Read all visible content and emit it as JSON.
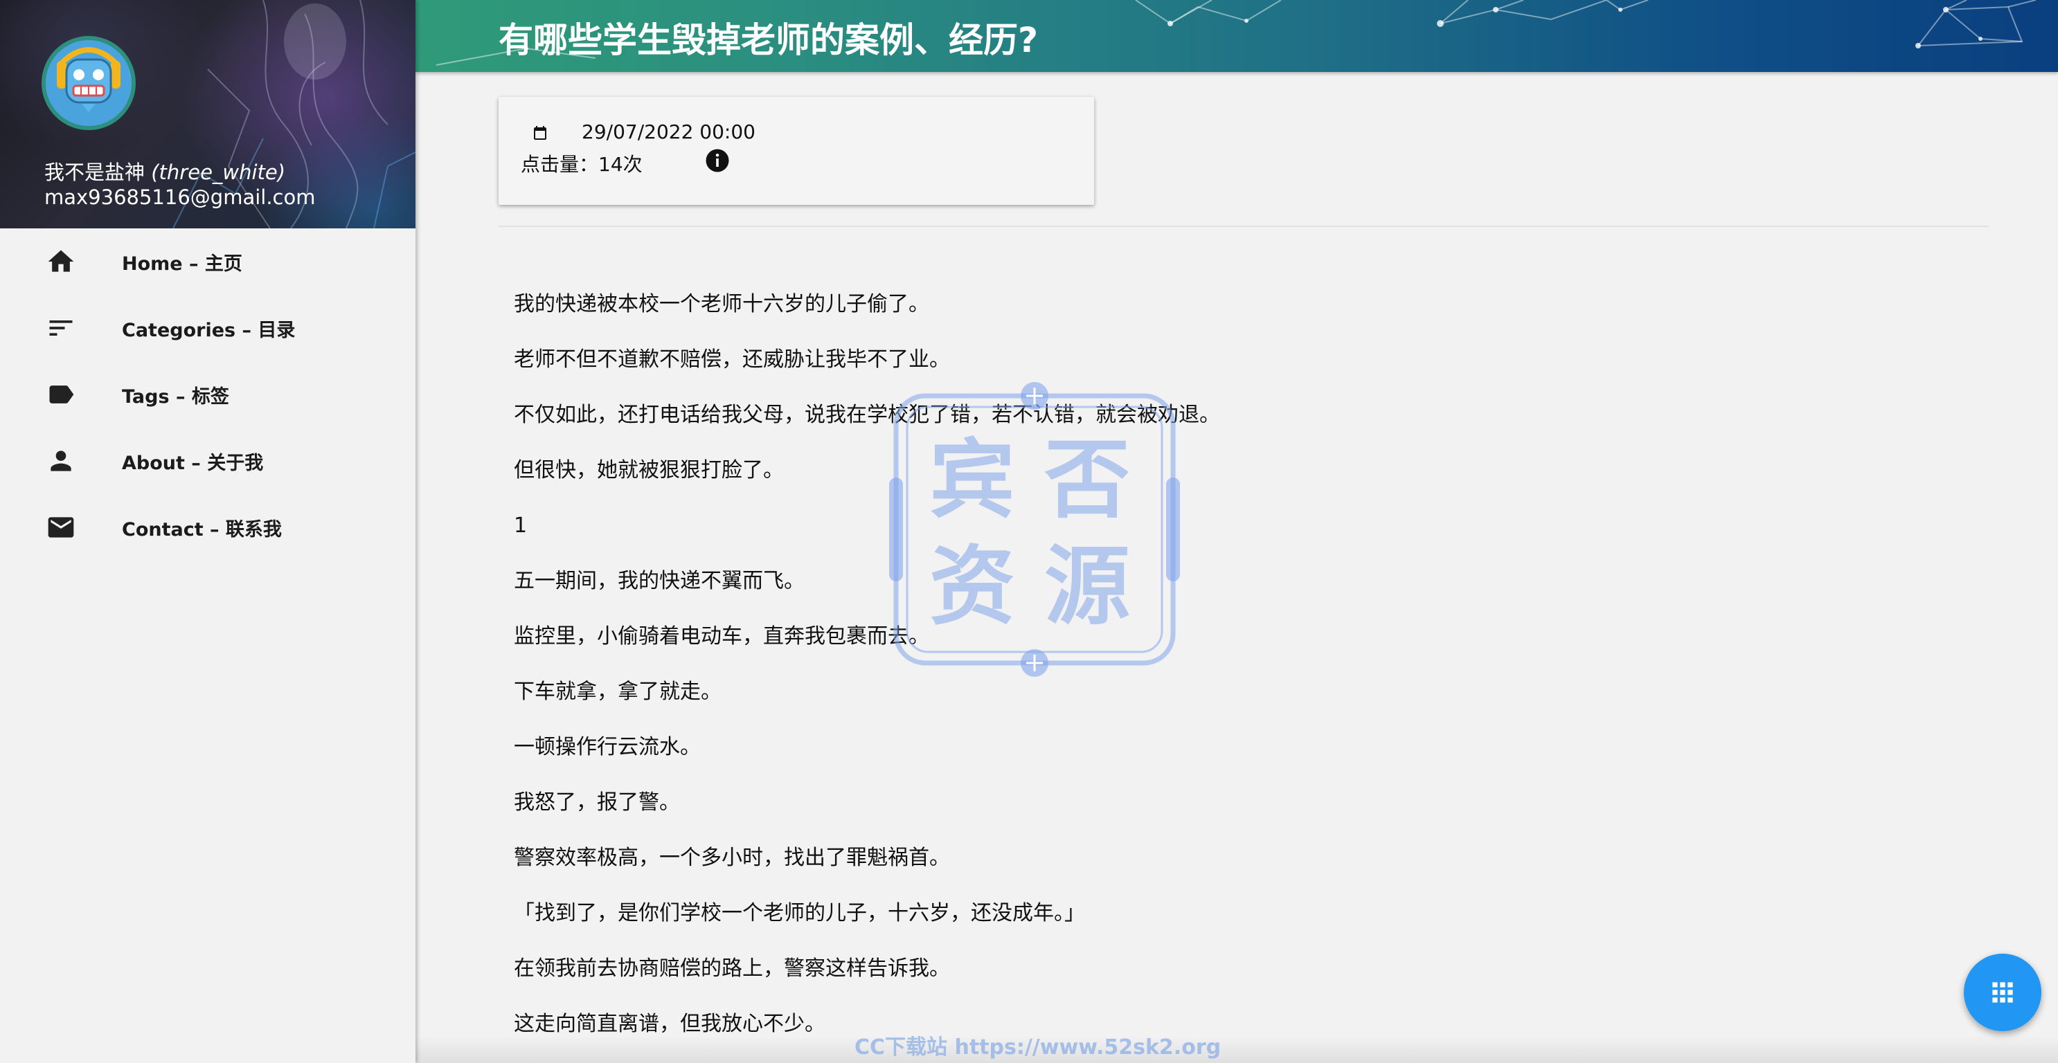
{
  "profile": {
    "name": "我不是盐神",
    "handle": "(three_white)",
    "email": "max93685116@gmail.com"
  },
  "nav": {
    "items": [
      {
        "label": "Home – 主页",
        "icon": "home-icon"
      },
      {
        "label": "Categories – 目录",
        "icon": "sort-icon"
      },
      {
        "label": "Tags – 标签",
        "icon": "label-icon"
      },
      {
        "label": "About – 关于我",
        "icon": "person-icon"
      },
      {
        "label": "Contact – 联系我",
        "icon": "mail-icon"
      }
    ]
  },
  "post": {
    "title": "有哪些学生毁掉老师的案例、经历?",
    "date": "29/07/2022 00:00",
    "views": "点击量：14次",
    "paragraphs": [
      "我的快递被本校一个老师十六岁的儿子偷了。",
      "老师不但不道歉不赔偿，还威胁让我毕不了业。",
      "不仅如此，还打电话给我父母，说我在学校犯了错，若不认错，就会被劝退。",
      "但很快，她就被狠狠打脸了。",
      "1",
      "五一期间，我的快递不翼而飞。",
      "监控里，小偷骑着电动车，直奔我包裹而去。",
      "下车就拿，拿了就走。",
      "一顿操作行云流水。",
      "我怒了，报了警。",
      "警察效率极高，一个多小时，找出了罪魁祸首。",
      "「找到了，是你们学校一个老师的儿子，十六岁，还没成年。」",
      "在领我前去协商赔偿的路上，警察这样告诉我。",
      "这走向简直离谱，但我放心不少。"
    ]
  },
  "watermark": {
    "stamp_chars": [
      "宾",
      "否",
      "资",
      "源"
    ],
    "footer": "CC下载站  https://www.52sk2.org"
  },
  "colors": {
    "fab": "#2196f3",
    "banner_start": "#2f9a78",
    "banner_end": "#0a3f7f"
  }
}
